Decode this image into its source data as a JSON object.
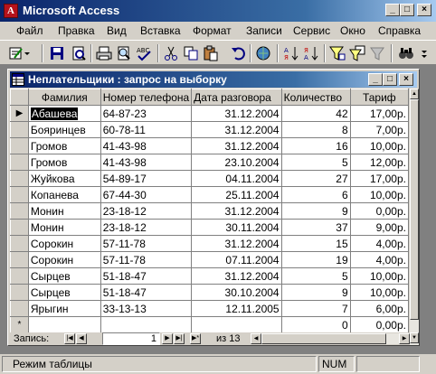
{
  "app": {
    "title": "Microsoft Access"
  },
  "menu": [
    "Файл",
    "Правка",
    "Вид",
    "Вставка",
    "Формат",
    "Записи",
    "Сервис",
    "Окно",
    "Справка"
  ],
  "query_window": {
    "title": "Неплательщики : запрос на выборку"
  },
  "columns": [
    "Фамилия",
    "Номер телефона",
    "Дата разговора",
    "Количество",
    "Тариф"
  ],
  "rows": [
    [
      "Абашева",
      "64-87-23",
      "31.12.2004",
      "42",
      "17,00р."
    ],
    [
      "Бояринцев",
      "60-78-11",
      "31.12.2004",
      "8",
      "7,00р."
    ],
    [
      "Громов",
      "41-43-98",
      "31.12.2004",
      "16",
      "10,00р."
    ],
    [
      "Громов",
      "41-43-98",
      "23.10.2004",
      "5",
      "12,00р."
    ],
    [
      "Жуйкова",
      "54-89-17",
      "04.11.2004",
      "27",
      "17,00р."
    ],
    [
      "Копанева",
      "67-44-30",
      "25.11.2004",
      "6",
      "10,00р."
    ],
    [
      "Монин",
      "23-18-12",
      "31.12.2004",
      "9",
      "0,00р."
    ],
    [
      "Монин",
      "23-18-12",
      "30.11.2004",
      "37",
      "9,00р."
    ],
    [
      "Сорокин",
      "57-11-78",
      "31.12.2004",
      "15",
      "4,00р."
    ],
    [
      "Сорокин",
      "57-11-78",
      "07.11.2004",
      "19",
      "4,00р."
    ],
    [
      "Сырцев",
      "51-18-47",
      "31.12.2004",
      "5",
      "10,00р."
    ],
    [
      "Сырцев",
      "51-18-47",
      "30.10.2004",
      "9",
      "10,00р."
    ],
    [
      "Ярыгин",
      "33-13-13",
      "12.11.2005",
      "7",
      "6,00р."
    ]
  ],
  "new_row": {
    "marker": "*",
    "quantity": "0",
    "tariff": "0,00р."
  },
  "navigation": {
    "label": "Запись:",
    "current": "1",
    "of_label": "из 13"
  },
  "status": {
    "mode": "Режим таблицы",
    "num": "NUM"
  },
  "colors": {
    "titlebar": "#0a246a",
    "face": "#d4d0c8",
    "mdi_background": "#808080"
  },
  "icons": [
    "ms-access-icon",
    "view-icon",
    "save-icon",
    "search-icon",
    "print-icon",
    "preview-icon",
    "spelling-icon",
    "cut-icon",
    "copy-icon",
    "paste-icon",
    "undo-icon",
    "hyperlink-icon",
    "sort-asc-icon",
    "sort-desc-icon",
    "filter-selection-icon",
    "filter-form-icon",
    "apply-filter-icon",
    "find-icon"
  ]
}
